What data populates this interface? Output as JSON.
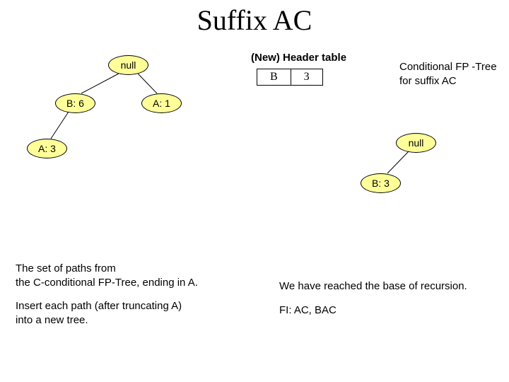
{
  "title": "Suffix AC",
  "left_tree": {
    "root": "null",
    "n_b6": "B: 6",
    "n_a1": "A: 1",
    "n_a3": "A: 3"
  },
  "header": {
    "label": "(New) Header table",
    "item": "B",
    "count": "3"
  },
  "right_tree": {
    "caption": "Conditional FP -Tree for suffix AC",
    "root": "null",
    "n_b3": "B: 3"
  },
  "bottom_left": {
    "line1": "The set of paths from",
    "line2": "the C-conditional FP-Tree, ending in A.",
    "line3": "Insert each path (after truncating A)",
    "line4": "into a new tree."
  },
  "bottom_right": {
    "line1": "We have reached the base of recursion.",
    "line2": "FI: AC, BAC"
  }
}
